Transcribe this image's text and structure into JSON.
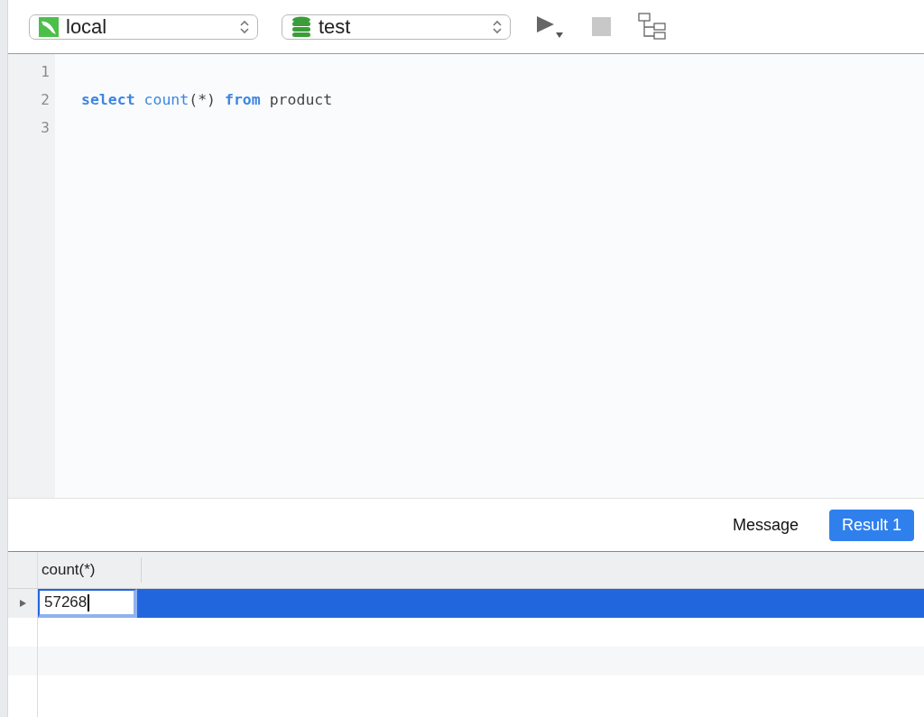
{
  "toolbar": {
    "connection": {
      "label": "local"
    },
    "database": {
      "label": "test"
    }
  },
  "editor": {
    "lines": [
      {
        "number": "1"
      },
      {
        "number": "2",
        "tokens": [
          {
            "kind": "keyword",
            "text": "select "
          },
          {
            "kind": "function",
            "text": "count"
          },
          {
            "kind": "plain",
            "text": "(*) "
          },
          {
            "kind": "keyword",
            "text": "from "
          },
          {
            "kind": "plain",
            "text": "product"
          }
        ]
      },
      {
        "number": "3"
      }
    ]
  },
  "result_tabs": [
    {
      "label": "Message",
      "selected": false
    },
    {
      "label": "Result 1",
      "selected": true
    }
  ],
  "grid": {
    "columns": [
      "count(*)"
    ],
    "rows": [
      {
        "cells": [
          "57268"
        ],
        "selected": true
      }
    ]
  }
}
